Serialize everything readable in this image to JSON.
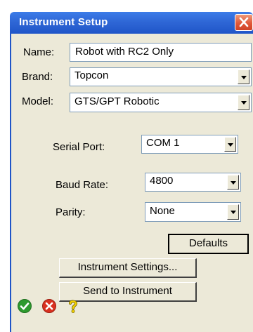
{
  "window": {
    "title": "Instrument Setup"
  },
  "form": {
    "name_label": "Name:",
    "name_value": "Robot with RC2 Only",
    "brand_label": "Brand:",
    "brand_value": "Topcon",
    "model_label": "Model:",
    "model_value": "GTS/GPT Robotic",
    "serial_port_label": "Serial Port:",
    "serial_port_value": "COM 1",
    "baud_rate_label": "Baud Rate:",
    "baud_rate_value": "4800",
    "parity_label": "Parity:",
    "parity_value": "None"
  },
  "buttons": {
    "defaults": "Defaults",
    "instrument_settings": "Instrument Settings...",
    "send_to_instrument": "Send to Instrument"
  },
  "icons": {
    "ok": "check-circle-icon",
    "cancel": "x-circle-icon",
    "help": "question-mark-icon"
  },
  "colors": {
    "titlebar": "#2f67d6",
    "dialog_bg": "#ece9d8",
    "close_button": "#e0583a",
    "ok_green": "#2e9a2e",
    "cancel_red": "#d9301f",
    "help_yellow": "#f5d300"
  }
}
